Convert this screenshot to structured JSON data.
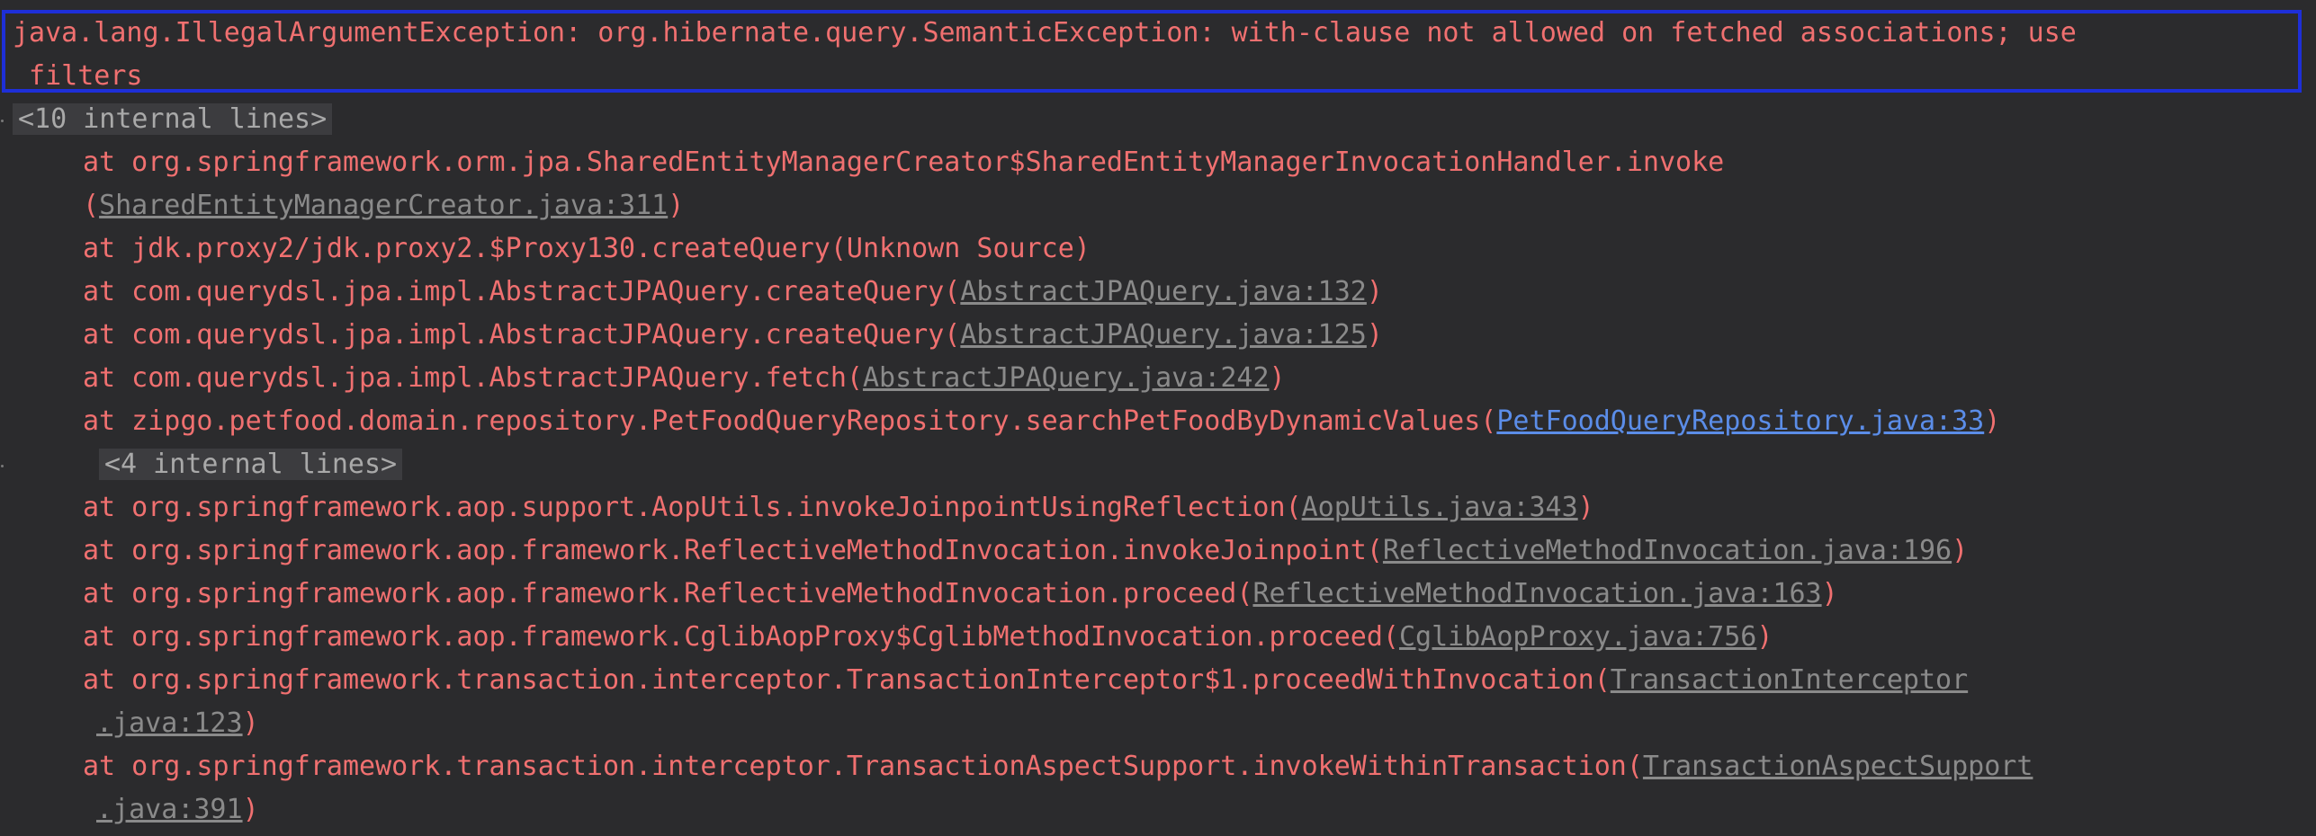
{
  "exception": {
    "line1": "java.lang.IllegalArgumentException: org.hibernate.query.SemanticException: with-clause not allowed on fetched associations; use",
    "line2": " filters"
  },
  "folds": {
    "first": "<10 internal lines>",
    "second": "<4 internal lines>"
  },
  "frames": [
    {
      "text": "at org.springframework.orm.jpa.SharedEntityManagerCreator$SharedEntityManagerInvocationHandler.invoke",
      "open": "",
      "link": "",
      "close": ""
    },
    {
      "text": "",
      "open": "(",
      "link": "SharedEntityManagerCreator.java:311",
      "close": ")"
    },
    {
      "text": "at jdk.proxy2/jdk.proxy2.$Proxy130.createQuery(Unknown Source)",
      "open": "",
      "link": "",
      "close": ""
    },
    {
      "text": "at com.querydsl.jpa.impl.AbstractJPAQuery.createQuery",
      "open": "(",
      "link": "AbstractJPAQuery.java:132",
      "close": ")"
    },
    {
      "text": "at com.querydsl.jpa.impl.AbstractJPAQuery.createQuery",
      "open": "(",
      "link": "AbstractJPAQuery.java:125",
      "close": ")"
    },
    {
      "text": "at com.querydsl.jpa.impl.AbstractJPAQuery.fetch",
      "open": "(",
      "link": "AbstractJPAQuery.java:242",
      "close": ")"
    },
    {
      "text": "at zipgo.petfood.domain.repository.PetFoodQueryRepository.searchPetFoodByDynamicValues",
      "open": "(",
      "link": "PetFoodQueryRepository.java:33",
      "close": ")"
    },
    {
      "text": "at org.springframework.aop.support.AopUtils.invokeJoinpointUsingReflection",
      "open": "(",
      "link": "AopUtils.java:343",
      "close": ")"
    },
    {
      "text": "at org.springframework.aop.framework.ReflectiveMethodInvocation.invokeJoinpoint",
      "open": "(",
      "link": "ReflectiveMethodInvocation.java:196",
      "close": ")"
    },
    {
      "text": "at org.springframework.aop.framework.ReflectiveMethodInvocation.proceed",
      "open": "(",
      "link": "ReflectiveMethodInvocation.java:163",
      "close": ")"
    },
    {
      "text": "at org.springframework.aop.framework.CglibAopProxy$CglibMethodInvocation.proceed",
      "open": "(",
      "link": "CglibAopProxy.java:756",
      "close": ")"
    },
    {
      "text": "at org.springframework.transaction.interceptor.TransactionInterceptor$1.proceedWithInvocation",
      "open": "(",
      "link": "TransactionInterceptor",
      "close": ""
    },
    {
      "text": "",
      "open": "",
      "link": ".java:123",
      "close": ")"
    },
    {
      "text": "at org.springframework.transaction.interceptor.TransactionAspectSupport.invokeWithinTransaction",
      "open": "(",
      "link": "TransactionAspectSupport",
      "close": ""
    },
    {
      "text": "",
      "open": "",
      "link": ".java:391",
      "close": ")"
    }
  ],
  "colors": {
    "background": "#2b2b2d",
    "error_text": "#f07070",
    "library_link": "#8a8a8a",
    "project_link": "#5b8de8",
    "highlight_border": "#1e2fd8"
  }
}
